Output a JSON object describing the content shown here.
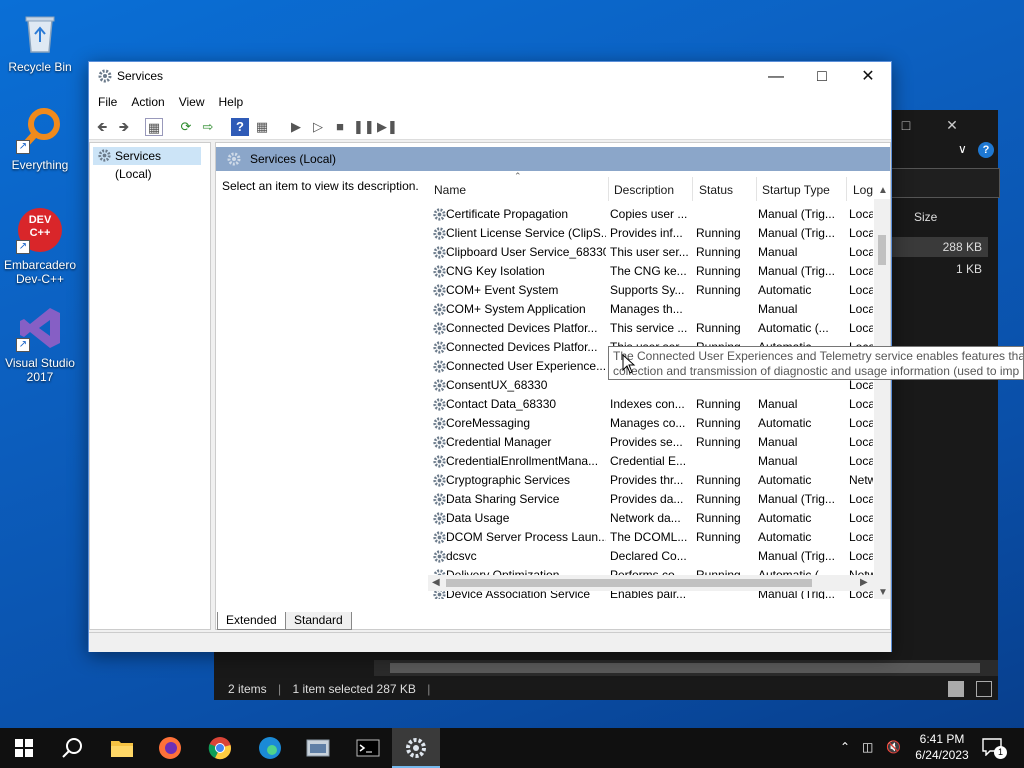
{
  "desktop": {
    "icons": [
      {
        "label": "Recycle Bin"
      },
      {
        "label": "Everything"
      },
      {
        "label": "Embarcadero Dev-C++",
        "icon_text": "DEV C++"
      },
      {
        "label": "Visual Studio 2017"
      }
    ]
  },
  "explorer": {
    "column_size": "Size",
    "files": [
      {
        "size": "288 KB"
      },
      {
        "size": "1 KB"
      }
    ],
    "status": {
      "items": "2 items",
      "selected": "1 item selected  287 KB"
    }
  },
  "services_window": {
    "title": "Services",
    "menu": [
      "File",
      "Action",
      "View",
      "Help"
    ],
    "tree": {
      "root": "Services (Local)"
    },
    "header": {
      "title": "Services (Local)"
    },
    "description_prompt": "Select an item to view its description.",
    "columns": {
      "name": "Name",
      "description": "Description",
      "status": "Status",
      "startup": "Startup Type",
      "logon": "Log"
    },
    "rows": [
      {
        "name": "Certificate Propagation",
        "description": "Copies user ...",
        "status": "",
        "startup": "Manual (Trig...",
        "logon": "Loca"
      },
      {
        "name": "Client License Service (ClipS...",
        "description": "Provides inf...",
        "status": "Running",
        "startup": "Manual (Trig...",
        "logon": "Loca"
      },
      {
        "name": "Clipboard User Service_68330",
        "description": "This user ser...",
        "status": "Running",
        "startup": "Manual",
        "logon": "Loca"
      },
      {
        "name": "CNG Key Isolation",
        "description": "The CNG ke...",
        "status": "Running",
        "startup": "Manual (Trig...",
        "logon": "Loca"
      },
      {
        "name": "COM+ Event System",
        "description": "Supports Sy...",
        "status": "Running",
        "startup": "Automatic",
        "logon": "Loca"
      },
      {
        "name": "COM+ System Application",
        "description": "Manages th...",
        "status": "",
        "startup": "Manual",
        "logon": "Loca"
      },
      {
        "name": "Connected Devices Platfor...",
        "description": "This service ...",
        "status": "Running",
        "startup": "Automatic (...",
        "logon": "Loca"
      },
      {
        "name": "Connected Devices Platfor...",
        "description": "This user ser...",
        "status": "Running",
        "startup": "Automatic",
        "logon": "Loca"
      },
      {
        "name": "Connected User Experience...",
        "description": "",
        "status": "",
        "startup": "",
        "logon": "Loca"
      },
      {
        "name": "ConsentUX_68330",
        "description": "",
        "status": "",
        "startup": "",
        "logon": "Loca"
      },
      {
        "name": "Contact Data_68330",
        "description": "Indexes con...",
        "status": "Running",
        "startup": "Manual",
        "logon": "Loca"
      },
      {
        "name": "CoreMessaging",
        "description": "Manages co...",
        "status": "Running",
        "startup": "Automatic",
        "logon": "Loca"
      },
      {
        "name": "Credential Manager",
        "description": "Provides se...",
        "status": "Running",
        "startup": "Manual",
        "logon": "Loca"
      },
      {
        "name": "CredentialEnrollmentMana...",
        "description": "Credential E...",
        "status": "",
        "startup": "Manual",
        "logon": "Loca"
      },
      {
        "name": "Cryptographic Services",
        "description": "Provides thr...",
        "status": "Running",
        "startup": "Automatic",
        "logon": "Netw"
      },
      {
        "name": "Data Sharing Service",
        "description": "Provides da...",
        "status": "Running",
        "startup": "Manual (Trig...",
        "logon": "Loca"
      },
      {
        "name": "Data Usage",
        "description": "Network da...",
        "status": "Running",
        "startup": "Automatic",
        "logon": "Loca"
      },
      {
        "name": "DCOM Server Process Laun...",
        "description": "The DCOML...",
        "status": "Running",
        "startup": "Automatic",
        "logon": "Loca"
      },
      {
        "name": "dcsvc",
        "description": "Declared Co...",
        "status": "",
        "startup": "Manual (Trig...",
        "logon": "Loca"
      },
      {
        "name": "Delivery Optimization",
        "description": "Performs co...",
        "status": "Running",
        "startup": "Automatic (...",
        "logon": "Netw"
      },
      {
        "name": "Device Association Service",
        "description": "Enables pair...",
        "status": "",
        "startup": "Manual (Trig...",
        "logon": "Loca"
      }
    ],
    "tabs": [
      "Extended",
      "Standard"
    ],
    "tooltip": {
      "line1": "The Connected User Experiences and Telemetry service enables features that su",
      "line2": "collection and transmission of diagnostic and usage information (used to imp"
    }
  },
  "taskbar": {
    "time": "6:41 PM",
    "date": "6/24/2023",
    "notification_count": "1"
  }
}
